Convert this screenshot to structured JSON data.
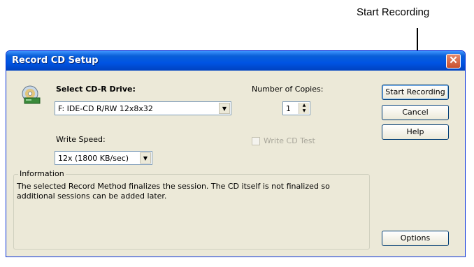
{
  "callout": {
    "label": "Start Recording"
  },
  "dialog": {
    "title": "Record CD Setup",
    "close_glyph": "✕",
    "drive": {
      "label": "Select CD-R Drive:",
      "value": "F: IDE-CD R/RW 12x8x32"
    },
    "speed": {
      "label": "Write Speed:",
      "value": "12x (1800 KB/sec)"
    },
    "copies": {
      "label": "Number of Copies:",
      "value": "1"
    },
    "test_checkbox": {
      "label": "Write CD Test",
      "checked": false,
      "enabled": false
    },
    "buttons": {
      "start": "Start Recording",
      "cancel": "Cancel",
      "help": "Help",
      "options": "Options"
    },
    "information": {
      "title": "Information",
      "text": "The selected Record Method finalizes the session. The CD itself is not finalized so additional sessions can be added later."
    }
  },
  "icons": {
    "drive": "cd-drive-icon",
    "dropdown": "chevron-down-icon",
    "spinner": "spinner-arrows-icon",
    "close": "close-icon"
  }
}
